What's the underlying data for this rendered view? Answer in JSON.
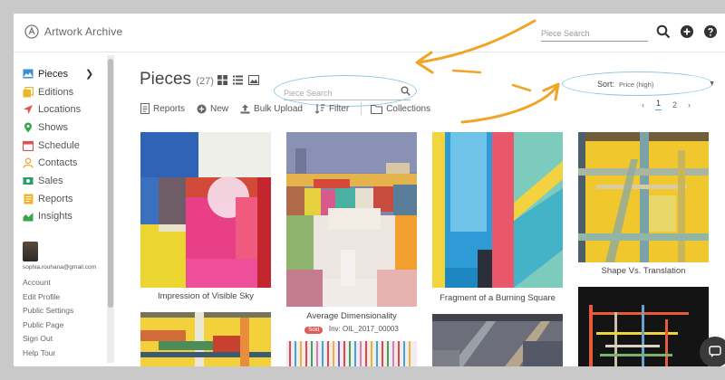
{
  "app": {
    "logo_text": "Artwork Archive"
  },
  "topbar": {
    "search_placeholder": "Piece Search"
  },
  "sidebar": {
    "items": [
      {
        "label": "Pieces",
        "icon": "image-icon",
        "color": "#3a8fd0"
      },
      {
        "label": "Editions",
        "icon": "editions-icon",
        "color": "#f0b42a"
      },
      {
        "label": "Locations",
        "icon": "location-arrow-icon",
        "color": "#e05252"
      },
      {
        "label": "Shows",
        "icon": "map-pin-icon",
        "color": "#3aa44c"
      },
      {
        "label": "Schedule",
        "icon": "calendar-icon",
        "color": "#e05252"
      },
      {
        "label": "Contacts",
        "icon": "user-icon",
        "color": "#f0a73a"
      },
      {
        "label": "Sales",
        "icon": "sales-icon",
        "color": "#2e9c6a"
      },
      {
        "label": "Reports",
        "icon": "reports-icon",
        "color": "#f0b42a"
      },
      {
        "label": "Insights",
        "icon": "insights-icon",
        "color": "#3aa44c"
      }
    ],
    "email": "sophia.rouhana@gmail.com",
    "account_links": [
      "Account",
      "Edit Profile",
      "Public Settings",
      "Public Page",
      "Sign Out",
      "Help Tour"
    ]
  },
  "main": {
    "title": "Pieces",
    "count": "(27)",
    "search_placeholder": "Piece Search",
    "toolbar": {
      "reports": "Reports",
      "new": "New",
      "bulk_upload": "Bulk Upload",
      "filter": "Filter",
      "collections": "Collections"
    },
    "sort": {
      "label": "Sort:",
      "value": "Price (high)"
    },
    "pager": {
      "prev": "‹",
      "page1": "1",
      "page2": "2",
      "next": "›"
    }
  },
  "pieces": [
    {
      "title": "Impression of Visible Sky"
    },
    {
      "title": "Average Dimensionality",
      "badge": "Sold",
      "inventory": "Inv: OIL_2017_00003"
    },
    {
      "title": "Fragment of a Burning Square"
    },
    {
      "title": "Shape Vs. Translation"
    }
  ],
  "colors": {
    "annotation_arrow": "#f0a526",
    "annotation_oval": "#8ec8e4",
    "sold_badge": "#e15b5b",
    "pager_underline": "#5aa6d6"
  }
}
